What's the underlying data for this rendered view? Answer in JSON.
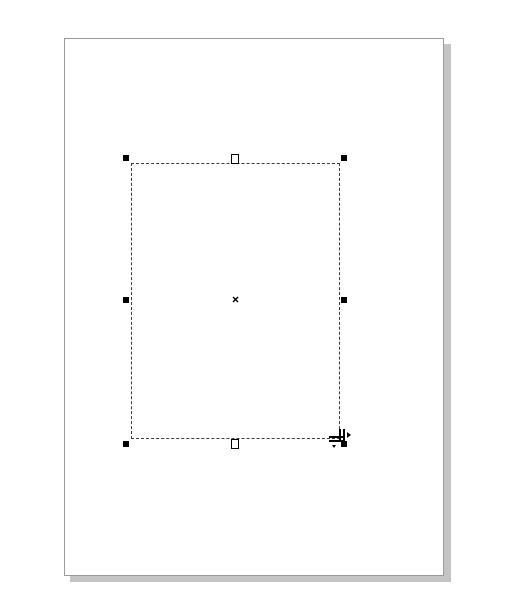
{
  "canvas": {
    "background_color": "#ffffff",
    "page_color": "#ffffff",
    "page_border_color": "#9a9a9a",
    "page_shadow_color": "#c4c4c4"
  },
  "selection": {
    "outline_style": "dashed",
    "handles": {
      "corner_style": "filled-square",
      "side_style": "filled-square",
      "top_bottom_style": "hollow-square"
    },
    "center_marker_icon": "x-mark-icon"
  },
  "cursor": {
    "icon": "resize-cursor-icon"
  }
}
